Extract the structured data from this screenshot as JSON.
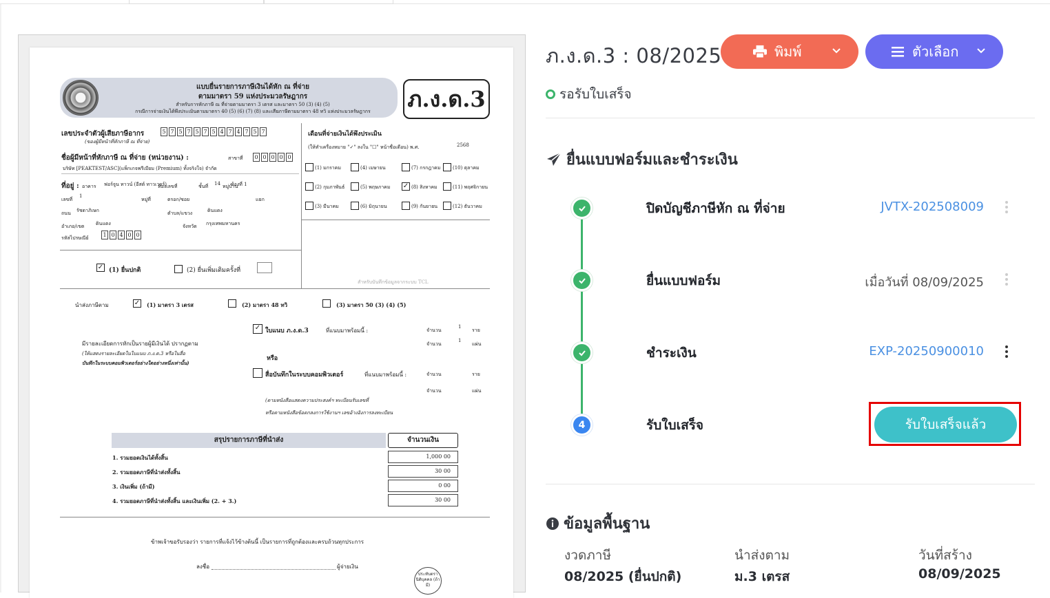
{
  "document": {
    "form_title_1": "แบบยื่นรายการภาษีเงินได้หัก ณ ที่จ่าย",
    "form_title_2": "ตามมาตรา 59 แห่งประมวลรัษฎากร",
    "form_sub_1": "สำหรับการหักภาษี ณ ที่จ่ายตามมาตรา 3 เตรส และมาตรา 50 (3) (4) (5)",
    "form_sub_2": "กรณีการจ่ายเงินได้พึงประเมินตามมาตรา 40 (5) (6) (7) (8) และเสียภาษีตามมาตรา 48 ทวิ แห่งประมวลรัษฎากร",
    "form_code": "ภ.ง.ด.3",
    "tax_id_label": "เลขประจำตัวผู้เสียภาษีอากร",
    "tax_id_note": "(ของผู้มีหน้าที่หักภาษี ณ ที่จ่าย)",
    "tax_id_digits": [
      "5",
      "7",
      "5",
      "7",
      "5",
      "7",
      "5",
      "4",
      "7",
      "4",
      "7",
      "5",
      "7"
    ],
    "payer_name_label": "ชื่อผู้มีหน้าที่หักภาษี ณ ที่จ่าย (หน่วยงาน) :",
    "branch_label": "สาขาที่",
    "branch_digits": [
      "0",
      "0",
      "0",
      "0",
      "0"
    ],
    "payer_name": "บริษัท [PEAKTEST/ASC](แพ็กเกจพรีเมียม (Premium) ทั้งจริงใจ) จำกัด",
    "address_label": "ที่อยู่ :",
    "building_label": "อาคาร",
    "building_value": "ฟอร์จูน ทาวน์ (อีสต์ ทาวเวอร์)",
    "room_label": "ห้องเลขที่",
    "floor_label": "ชั้นที่",
    "floor_value": "14",
    "village_label": "หมู่บ้าน",
    "village_value": "ห้องที่ 1",
    "house_no_label": "เลขที่",
    "house_no_value": "1",
    "moo_label": "หมู่ที่",
    "soi_label": "ตรอก/ซอย",
    "yaek_label": "แยก",
    "road_label": "ถนน",
    "road_value": "รัชดาภิเษก",
    "subdistrict_label": "ตำบล/แขวง",
    "subdistrict_value": "ดินแดง",
    "district_label": "อำเภอ/เขต",
    "district_value": "ดินแดง",
    "province_label": "จังหวัด",
    "province_value": "กรุงเทพมหานคร",
    "postal_label": "รหัสไปรษณีย์",
    "postal_digits": [
      "1",
      "0",
      "4",
      "0",
      "0"
    ],
    "month_label": "เดือนที่จ่ายเงินได้พึงประเมิน",
    "month_note": "(ให้ทำเครื่องหมาย \"✓\" ลงใน \"☐\" หน้าชื่อเดือน) พ.ศ.",
    "year_value": "2568",
    "months": [
      "(1) มกราคม",
      "(4) เมษายน",
      "(7) กรกฎาคม",
      "(10) ตุลาคม",
      "(2) กุมภาพันธ์",
      "(5) พฤษภาคม",
      "(8) สิงหาคม",
      "(11) พฤศจิกายน",
      "(3) มีนาคม",
      "(6) มิถุนายน",
      "(9) กันยายน",
      "(12) ธันวาคม"
    ],
    "checked_month_index": 6,
    "filing_normal": "(1) ยื่นปกติ",
    "filing_extra": "(2)  ยื่นเพิ่มเติมครั้งที่",
    "tcl_note": "สำหรับบันทึกข้อมูลจากระบบ TCL",
    "submit_under": "นำส่งภาษีตาม",
    "sec_opts": [
      "(1)  มาตรา 3 เตรส",
      "(2)  มาตรา 48 ทวิ",
      "(3) มาตรา 50 (3) (4) (5)"
    ],
    "detail_1": "มีรายละเอียดการหักเป็นรายผู้มีเงินได้ ปรากฏตาม",
    "detail_2": "(ให้แสดงรายละเอียดในใบแนบ ภ.ง.ด.3 หรือในสื่อ",
    "detail_3": "บันทึกในระบบคอมพิวเตอร์อย่างใดอย่างหนึ่งเท่านั้น)",
    "attach_label": "ใบแนบ ภ.ง.ด.3",
    "attach_suffix": "ที่แนบมาพร้อมนี้ :",
    "or_label": "หรือ",
    "media_label": "สื่อบันทึกในระบบคอมพิวเตอร์",
    "media_suffix": "ที่แนบมาพร้อมนี้ :",
    "count_label": "จำนวน",
    "count_1": "1",
    "unit_rai": "ราย",
    "unit_page": "แผ่น",
    "note_1": "(ตามหนังสือแสดงความประสงค์ฯ ทะเบียนรับเลขที่",
    "note_2": "หรือตามหนังสือข้อตกลงการใช้งานฯ เลขอ้างอิงการลงทะเบียน",
    "summary_title": "สรุปรายการภาษีที่นำส่ง",
    "amount_title": "จำนวนเงิน",
    "summary_rows": [
      {
        "label": "1. รวมยอดเงินได้ทั้งสิ้น",
        "amount": "1,000 00"
      },
      {
        "label": "2. รวมยอดภาษีที่นำส่งทั้งสิ้น",
        "amount": "30 00"
      },
      {
        "label": "3. เงินเพิ่ม (ถ้ามี)",
        "amount": "0 00"
      },
      {
        "label": "4. รวมยอดภาษีที่นำส่งทั้งสิ้น และเงินเพิ่ม (2. + 3.)",
        "amount": "30 00"
      }
    ],
    "certify": "ข้าพเจ้าขอรับรองว่า รายการที่แจ้งไว้ข้างต้นนี้ เป็นรายการที่ถูกต้องและครบถ้วนทุกประการ",
    "sign_label": "ลงชื่อ",
    "payer_label": "ผู้จ่ายเงิน",
    "stamp_text": "ประทับตรา นิติบุคคล (ถ้ามี)"
  },
  "header": {
    "title": "ภ.ง.ด.3 : 08/2025",
    "print_label": "พิมพ์",
    "options_label": "ตัวเลือก",
    "status": "รอรับใบเสร็จ"
  },
  "colors": {
    "print": "#f26b55",
    "options": "#6b6cf0",
    "done": "#3cb46b",
    "current": "#3a86f0",
    "receipt_btn": "#3ec1c9",
    "highlight": "#e50000",
    "link": "#4a90e2"
  },
  "steps_section": {
    "title": "ยื่นแบบฟอร์มและชำระเงิน",
    "icon": "paper-plane-icon",
    "steps": [
      {
        "label": "ปิดบัญชีภาษีหัก ณ ที่จ่าย",
        "value": "JVTX-202508009",
        "status": "done"
      },
      {
        "label": "ยื่นแบบฟอร์ม",
        "value": "เมื่อวันที่ 08/09/2025",
        "status": "done"
      },
      {
        "label": "ชำระเงิน",
        "value": "EXP-20250900010",
        "status": "done"
      },
      {
        "label": "รับใบเสร็จ",
        "number": "4",
        "button": "รับใบเสร็จแล้ว",
        "status": "current"
      }
    ]
  },
  "info_section": {
    "title": "ข้อมูลพื้นฐาน",
    "icon": "info-icon",
    "fields": [
      {
        "label": "งวดภาษี",
        "value": "08/2025 (ยื่นปกติ)"
      },
      {
        "label": "นำส่งตาม",
        "value": "ม.3 เตรส"
      },
      {
        "label": "วันที่สร้าง",
        "value": "08/09/2025"
      }
    ]
  }
}
